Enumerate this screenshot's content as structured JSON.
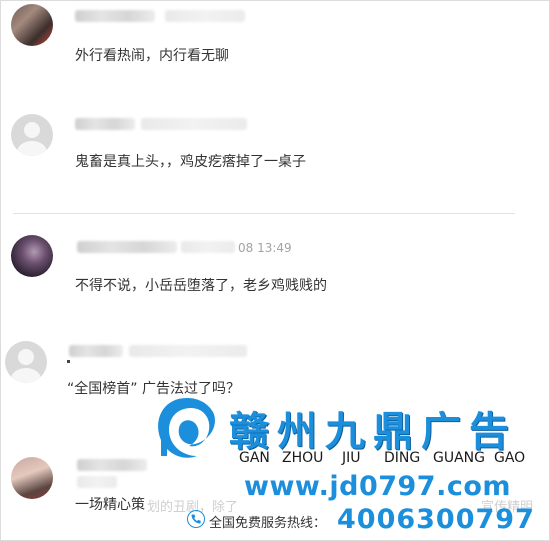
{
  "comments": [
    {
      "time": "",
      "text": "外行看热闹，内行看无聊"
    },
    {
      "time": "",
      "text": "鬼畜是真上头，，鸡皮疙瘩掉了一桌子"
    },
    {
      "time": "08 13:49",
      "text": "不得不说，小岳岳堕落了，老乡鸡贱贱的"
    },
    {
      "time": "",
      "text": "“全国榜首” 广告法过了吗？"
    },
    {
      "time": "",
      "text": "一场精心策"
    }
  ],
  "watermark": {
    "brand": "赣州九鼎广告",
    "pinyin": [
      "GAN",
      "ZHOU",
      "JIU",
      "DING",
      "GUANG",
      "GAO"
    ],
    "url": "www.jd0797.com",
    "hotline_label": "全国免费服务热线：",
    "phone": "4006300797",
    "ghost_text_left": "划的丑剧，除了",
    "ghost_text_right": "宣传精明"
  },
  "colors": {
    "brand_blue": "#1b8fdc",
    "divider": "#e2e2e2",
    "meta_gray": "#a3a3a3"
  }
}
